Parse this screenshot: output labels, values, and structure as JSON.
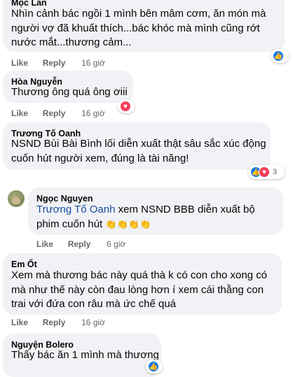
{
  "comments": [
    {
      "author": "Mộc Lan",
      "lines": [
        "Nhìn cảnh bác ngồi 1 mình bên mâm cơm, ăn món mà",
        "người vợ đã khuất thích...bác khóc mà mình cũng rớt",
        "nước mắt...thương cảm..."
      ],
      "like": "Like",
      "reply": "Reply",
      "time": "16 giờ"
    },
    {
      "author": "Hòa Nguyễn",
      "lines": [
        "Thương ông quá ông ơiii"
      ],
      "like": "Like",
      "reply": "Reply",
      "time": "16 giờ"
    },
    {
      "author": "Trương Tố Oanh",
      "lines": [
        "NSND Bùi Bài Bình lối diễn xuất thật sâu sắc xúc động",
        "cuốn hút người xem, đúng là tài năng!"
      ],
      "reaction_count": "3"
    },
    {
      "author": "Ngọc Nguyen",
      "mention": "Trương Tố Oanh",
      "line1_rest": " xem NSND BBB diễn xuất bộ",
      "line2": "phim cuốn hút ",
      "emojis": "👏👏👏👏",
      "like": "Like",
      "reply": "Reply",
      "time": "6 giờ"
    },
    {
      "author": "Em Ốt",
      "lines": [
        "Xem mà thương bác này quá thà k có con cho xong có",
        "mà như thế này còn đau lòng hơn í xem cái thằng con",
        "trai với đứa con râu mà ức chế quá"
      ],
      "like": "Like",
      "reply": "Reply",
      "time": "16 giờ"
    },
    {
      "author": "Nguyện Bolero",
      "lines": [
        "Thấy bác ăn 1 mình mà thương"
      ]
    }
  ],
  "icons": {
    "like": "like-icon",
    "love": "love-icon",
    "avatar": "avatar"
  },
  "colors": {
    "like_blue": "#1877f2",
    "love_red": "#f33e58",
    "bubble": "#f0f2f5",
    "meta_gray": "#65676b"
  }
}
